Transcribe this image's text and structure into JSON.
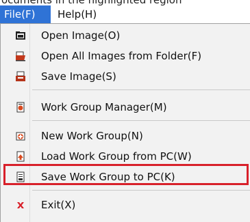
{
  "menubar": {
    "file_label": "File(F)",
    "help_label": "Help(H)"
  },
  "file_menu": {
    "items": [
      {
        "label": "Open Image(O)",
        "icon": "open-image-icon"
      },
      {
        "label": "Open All Images from Folder(F)",
        "icon": "open-folder-icon"
      },
      {
        "label": "Save Image(S)",
        "icon": "save-image-icon"
      },
      {
        "label": "Work Group Manager(M)",
        "icon": "work-group-manager-icon"
      },
      {
        "label": "New Work Group(N)",
        "icon": "new-work-group-icon"
      },
      {
        "label": "Load Work Group from PC(W)",
        "icon": "load-work-group-icon"
      },
      {
        "label": "Save Work Group to PC(K)",
        "icon": "save-work-group-icon"
      },
      {
        "label": "Exit(X)",
        "icon": "exit-icon"
      }
    ]
  },
  "highlight_color": "#d8202a",
  "accent_color": "#2f73d6"
}
